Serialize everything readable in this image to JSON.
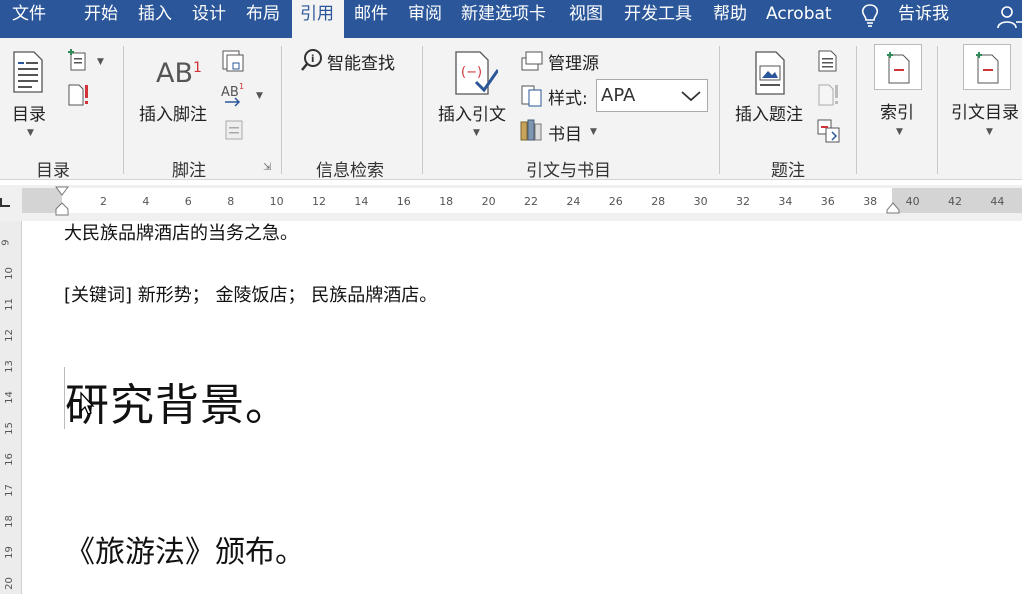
{
  "tabs": [
    {
      "label": "文件"
    },
    {
      "label": "开始"
    },
    {
      "label": "插入"
    },
    {
      "label": "设计"
    },
    {
      "label": "布局"
    },
    {
      "label": "引用"
    },
    {
      "label": "邮件"
    },
    {
      "label": "审阅"
    },
    {
      "label": "新建选项卡"
    },
    {
      "label": "视图"
    },
    {
      "label": "开发工具"
    },
    {
      "label": "帮助"
    },
    {
      "label": "Acrobat"
    },
    {
      "label": "告诉我"
    }
  ],
  "active_tab": "引用",
  "ribbon": {
    "toc": {
      "button": "目录",
      "group": "目录"
    },
    "footnotes": {
      "insert_footnote": "插入脚注",
      "ab_icon_text": "AB",
      "ab_superscript": "1",
      "group": "脚注"
    },
    "research": {
      "smart_lookup": "智能查找",
      "group": "信息检索"
    },
    "citations": {
      "insert_citation": "插入引文",
      "manage_sources": "管理源",
      "style_label": "样式:",
      "style_value": "APA",
      "bibliography": "书目",
      "group": "引文与书目"
    },
    "captions": {
      "insert_caption": "插入题注",
      "group": "题注"
    },
    "index": {
      "mark_entry": "索引"
    },
    "authorities": {
      "mark_citation": "引文目录"
    }
  },
  "ruler": {
    "numbers": [
      "2",
      "4",
      "6",
      "8",
      "10",
      "12",
      "14",
      "16",
      "18",
      "20",
      "22",
      "24",
      "26",
      "28",
      "30",
      "32",
      "34",
      "36",
      "38",
      "40",
      "42",
      "44"
    ],
    "vnumbers": [
      "9",
      "10",
      "11",
      "12",
      "13",
      "14",
      "15",
      "16",
      "17",
      "18",
      "19",
      "20"
    ]
  },
  "document": {
    "line1": "大民族品牌酒店的当务之急。",
    "keywords": "[关键词]  新形势；   金陵饭店；   民族品牌酒店。",
    "heading": "研究背景。",
    "line_law": "《旅游法》颁布。"
  },
  "colors": {
    "accent": "#2b579a",
    "ribbon_bg": "#f3f3f3"
  }
}
